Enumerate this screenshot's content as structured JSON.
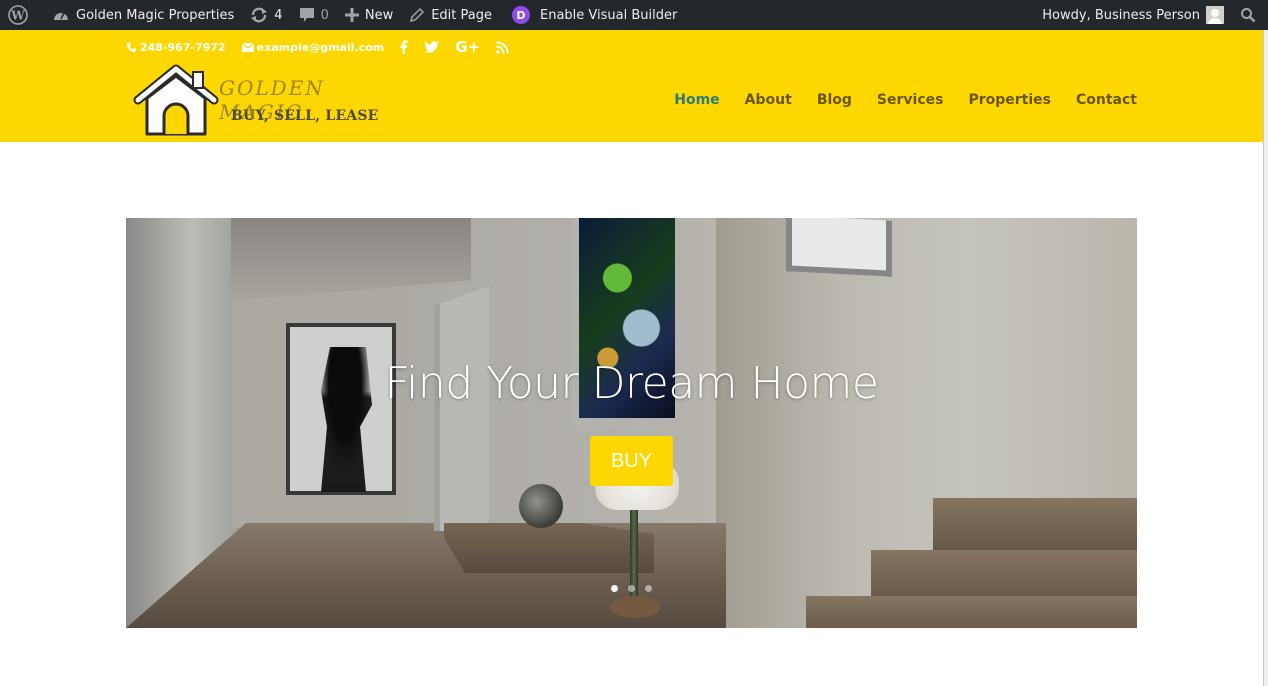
{
  "admin_bar": {
    "wp_logo_icon": "wordpress-icon",
    "site_name": "Golden Magic Properties",
    "updates_count": "4",
    "comments_count": "0",
    "new_label": "New",
    "edit_label": "Edit Page",
    "divi_letter": "D",
    "visual_builder_label": "Enable Visual Builder",
    "howdy": "Howdy, Business Person"
  },
  "topbar": {
    "phone": "248-967-7972",
    "email": "example@gmail.com",
    "social": [
      "facebook",
      "twitter",
      "google-plus",
      "rss"
    ],
    "google_plus_glyph": "G+"
  },
  "logo": {
    "brand": "GOLDEN MAGIC",
    "tagline": "BUY, SELL, LEASE"
  },
  "nav": {
    "items": [
      {
        "label": "Home",
        "active": true
      },
      {
        "label": "About"
      },
      {
        "label": "Blog"
      },
      {
        "label": "Services"
      },
      {
        "label": "Properties"
      },
      {
        "label": "Contact"
      }
    ]
  },
  "hero": {
    "title": "Find Your Dream Home",
    "button_label": "BUY",
    "slide_count": 3,
    "active_slide": 1
  },
  "colors": {
    "admin_bar_bg": "#23282d",
    "header_bg": "#ffd700",
    "button_bg": "#ffd700",
    "nav_active": "#2b7c7c",
    "divi_purple": "#8e4be8"
  }
}
